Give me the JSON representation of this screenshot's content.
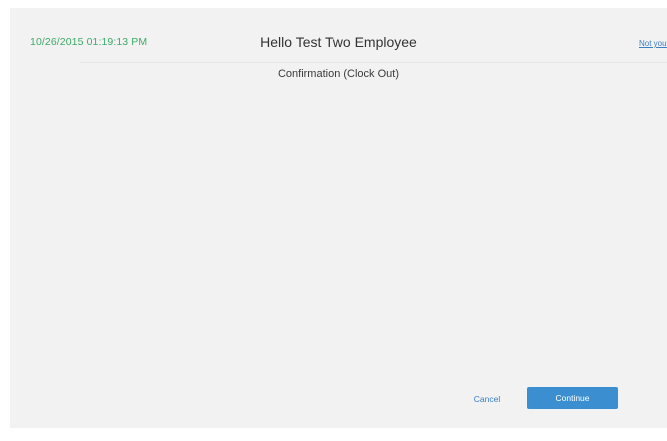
{
  "header": {
    "timestamp": "10/26/2015 01:19:13 PM",
    "greeting": "Hello Test Two Employee",
    "not_you_link": "Not you?"
  },
  "main": {
    "subtitle": "Confirmation (Clock Out)"
  },
  "footer": {
    "cancel_label": "Cancel",
    "continue_label": "Continue"
  },
  "colors": {
    "timestamp": "#3fa96a",
    "link": "#3a7fc4",
    "primary_button": "#3b8fd0",
    "background": "#f2f2f2"
  }
}
